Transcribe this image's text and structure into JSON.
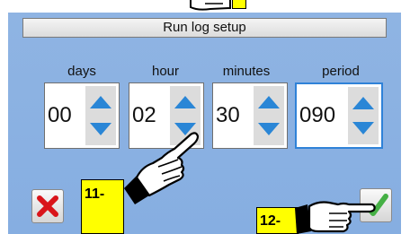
{
  "dialog": {
    "title": "Run log setup"
  },
  "fields": [
    {
      "label": "days",
      "value": "00"
    },
    {
      "label": "hour",
      "value": "02"
    },
    {
      "label": "minutes",
      "value": "30"
    },
    {
      "label": "period",
      "value": "090"
    }
  ],
  "buttons": {
    "cancel_icon": "red-x-icon",
    "confirm_icon": "green-check-icon"
  },
  "annotations": {
    "callout_11": "11-",
    "callout_12": "12-"
  },
  "colors": {
    "background": "#8fb4e3",
    "active_border": "#2f82d8",
    "arrow_blue": "#2a86d6",
    "callout": "#ffff00",
    "cancel": "#d9141a",
    "confirm": "#45b045"
  }
}
